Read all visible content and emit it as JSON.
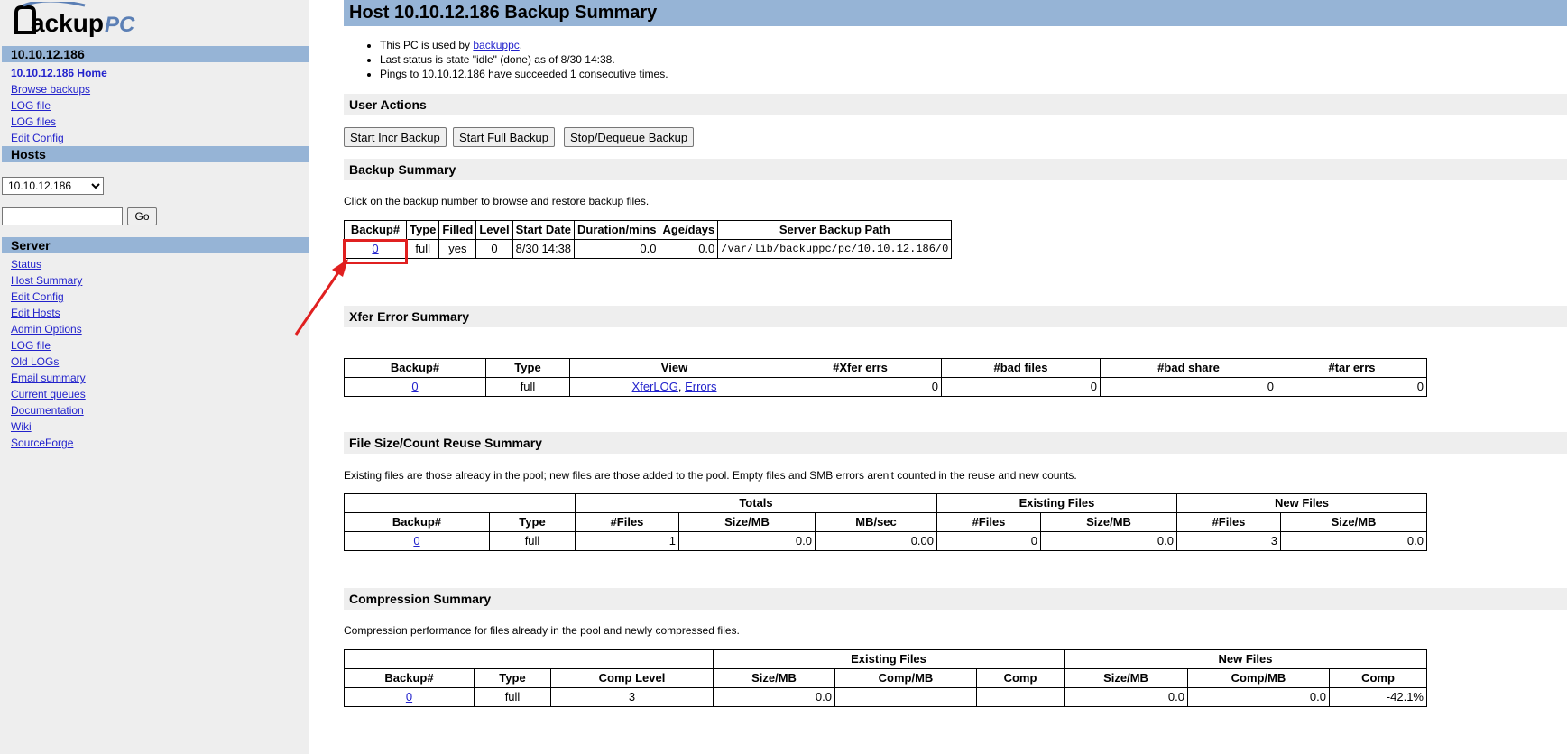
{
  "sidebar": {
    "logo_text": "BackupPC",
    "host_heading": "10.10.12.186",
    "host_links": [
      "10.10.12.186 Home",
      "Browse backups",
      "LOG file",
      "LOG files",
      "Edit Config"
    ],
    "hosts_heading": "Hosts",
    "host_select_value": "10.10.12.186",
    "go_label": "Go",
    "server_heading": "Server",
    "server_links": [
      "Status",
      "Host Summary",
      "Edit Config",
      "Edit Hosts",
      "Admin Options",
      "LOG file",
      "Old LOGs",
      "Email summary",
      "Current queues",
      "Documentation",
      "Wiki",
      "SourceForge"
    ]
  },
  "main": {
    "title": "Host 10.10.12.186 Backup Summary",
    "status": {
      "line1_prefix": "This PC is used by ",
      "line1_link": "backuppc",
      "line1_suffix": ".",
      "line2": "Last status is state \"idle\" (done) as of 8/30 14:38.",
      "line3": "Pings to 10.10.12.186 have succeeded 1 consecutive times."
    },
    "user_actions": {
      "heading": "User Actions",
      "buttons": [
        "Start Incr Backup",
        "Start Full Backup",
        "Stop/Dequeue Backup"
      ]
    },
    "backup_summary": {
      "heading": "Backup Summary",
      "intro": "Click on the backup number to browse and restore backup files.",
      "headers": [
        "Backup#",
        "Type",
        "Filled",
        "Level",
        "Start Date",
        "Duration/mins",
        "Age/days",
        "Server Backup Path"
      ],
      "rows": [
        {
          "backup": "0",
          "type": "full",
          "filled": "yes",
          "level": "0",
          "start": "8/30 14:38",
          "duration": "0.0",
          "age": "0.0",
          "path": "/var/lib/backuppc/pc/10.10.12.186/0"
        }
      ]
    },
    "xfer_summary": {
      "heading": "Xfer Error Summary",
      "headers": [
        "Backup#",
        "Type",
        "View",
        "#Xfer errs",
        "#bad files",
        "#bad share",
        "#tar errs"
      ],
      "rows": [
        {
          "backup": "0",
          "type": "full",
          "view_link1": "XferLOG",
          "view_sep": ", ",
          "view_link2": "Errors",
          "xfer_errs": "0",
          "bad_files": "0",
          "bad_share": "0",
          "tar_errs": "0"
        }
      ]
    },
    "reuse_summary": {
      "heading": "File Size/Count Reuse Summary",
      "intro": "Existing files are those already in the pool; new files are those added to the pool. Empty files and SMB errors aren't counted in the reuse and new counts.",
      "group_headers": [
        "Totals",
        "Existing Files",
        "New Files"
      ],
      "headers": [
        "Backup#",
        "Type",
        "#Files",
        "Size/MB",
        "MB/sec",
        "#Files",
        "Size/MB",
        "#Files",
        "Size/MB"
      ],
      "rows": [
        {
          "backup": "0",
          "type": "full",
          "tot_files": "1",
          "tot_size": "0.0",
          "tot_rate": "0.00",
          "ex_files": "0",
          "ex_size": "0.0",
          "new_files": "3",
          "new_size": "0.0"
        }
      ]
    },
    "compression_summary": {
      "heading": "Compression Summary",
      "intro": "Compression performance for files already in the pool and newly compressed files.",
      "group_headers": [
        "Existing Files",
        "New Files"
      ],
      "headers": [
        "Backup#",
        "Type",
        "Comp Level",
        "Size/MB",
        "Comp/MB",
        "Comp",
        "Size/MB",
        "Comp/MB",
        "Comp"
      ],
      "rows": [
        {
          "backup": "0",
          "type": "full",
          "comp_level": "3",
          "ex_size": "0.0",
          "ex_comp_mb": "",
          "ex_comp": "",
          "new_size": "0.0",
          "new_comp_mb": "0.0",
          "new_comp": "-42.1%"
        }
      ]
    }
  },
  "annotation_color": "#e02020"
}
